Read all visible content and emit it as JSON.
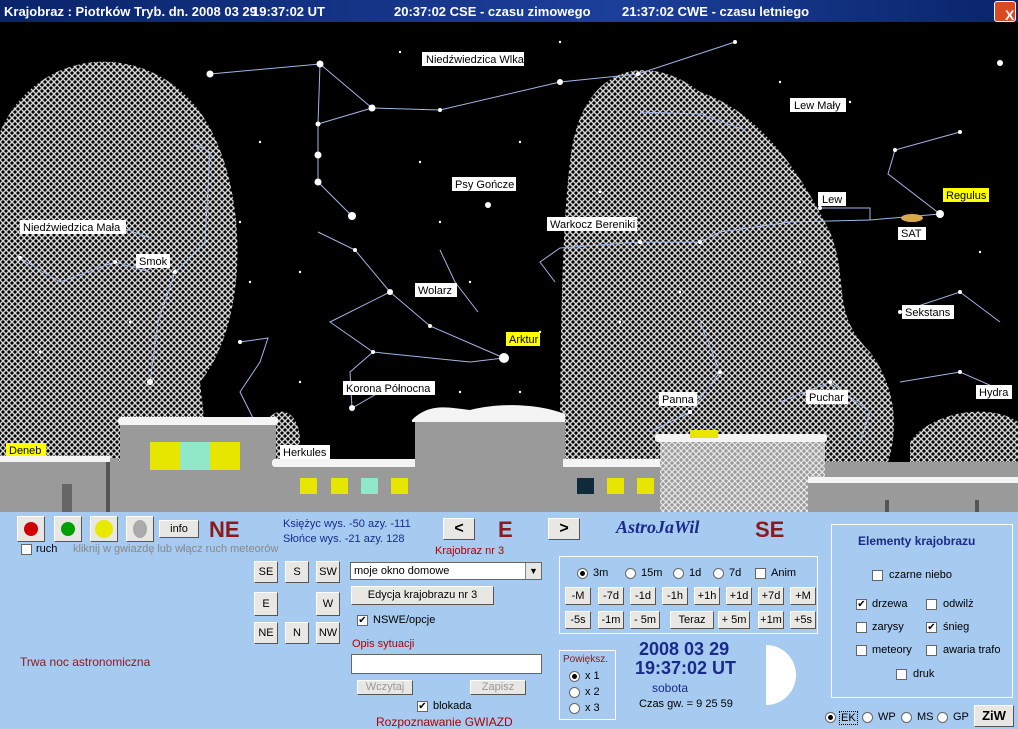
{
  "title": {
    "location": "Krajobraz : Piotrków Tryb. dn. 2008 03 29",
    "ut": "19:37:02 UT",
    "cse": "20:37:02 CSE - czasu zimowego",
    "cwe": "21:37:02 CWE - czasu letniego",
    "close": "X"
  },
  "sky": {
    "constellations": [
      "Niedźwiedzica Wlka",
      "Lew Mały",
      "Psy Gończe",
      "Lew",
      "Niedźwiedzica Mała",
      "Smok",
      "Warkocz Bereniki",
      "Wolarz",
      "Korona Północna",
      "Herkules",
      "Panna",
      "Puchar",
      "Sekstans",
      "Hydra"
    ],
    "highlighted": [
      "Regulus",
      "Arktur",
      "Deneb"
    ],
    "planet_label": "SAT",
    "colors": {
      "sky": "#000000",
      "lines": "#9fb7e6",
      "highlight": "#ffff00",
      "ground": "#9a9a9a"
    }
  },
  "panel": {
    "dots": [
      "#d00000",
      "#00a000",
      "#e8e800",
      "#aaaaaa"
    ],
    "info": "info",
    "dir_left": "NE",
    "dir_center": "E",
    "dir_right": "SE",
    "prev": "<",
    "next": ">",
    "app_name": "AstroJaWil",
    "ruch_label": "ruch",
    "hint": "kliknij w gwiazdę lub włącz ruch meteorów",
    "moon_line": "Księżyc wys. -50   azy. -111",
    "sun_line": "Słońce wys. -21   azy. 128",
    "landscape_no": "Krajobraz nr 3",
    "compass": {
      "SE": "SE",
      "S": "S",
      "SW": "SW",
      "E": "E",
      "W": "W",
      "NE": "NE",
      "N": "N",
      "NW": "NW"
    },
    "landscape_select": "moje okno domowe",
    "edit_landscape": "Edycja krajobrazu nr 3",
    "nswe_label": "NSWE/opcje",
    "desc_label": "Opis sytuacji",
    "desc_value": "",
    "read_btn": "Wczytaj",
    "save_btn": "Zapisz",
    "lock_label": "blokada",
    "recognize": "Rozpoznawanie GWIAZD",
    "status": "Trwa noc astronomiczna",
    "step_options": [
      "3m",
      "15m",
      "1d",
      "7d"
    ],
    "anim_label": "Anim",
    "step_row1": [
      "-M",
      "-7d",
      "-1d",
      "-1h",
      "+1h",
      "+1d",
      "+7d",
      "+M"
    ],
    "step_row2": [
      "-5s",
      "-1m",
      "- 5m",
      "Teraz",
      "+ 5m",
      "+1m",
      "+5s"
    ],
    "zoom_title": "Powiększ.",
    "zoom_options": [
      "x 1",
      "x 2",
      "x 3"
    ],
    "date": "2008 03 29",
    "time": "19:37:02 UT",
    "weekday": "sobota",
    "sidereal": "Czas gw. =    9 25 59",
    "elements": {
      "title": "Elementy krajobrazu",
      "black_sky": "czarne niebo",
      "trees": "drzewa",
      "thaw": "odwilż",
      "outlines": "zarysy",
      "snow": "śnieg",
      "meteors": "meteory",
      "power_fail": "awaria trafo",
      "print": "druk"
    },
    "lang_options": [
      "EK",
      "WP",
      "MS",
      "GP"
    ],
    "ziw": "ZiW"
  }
}
